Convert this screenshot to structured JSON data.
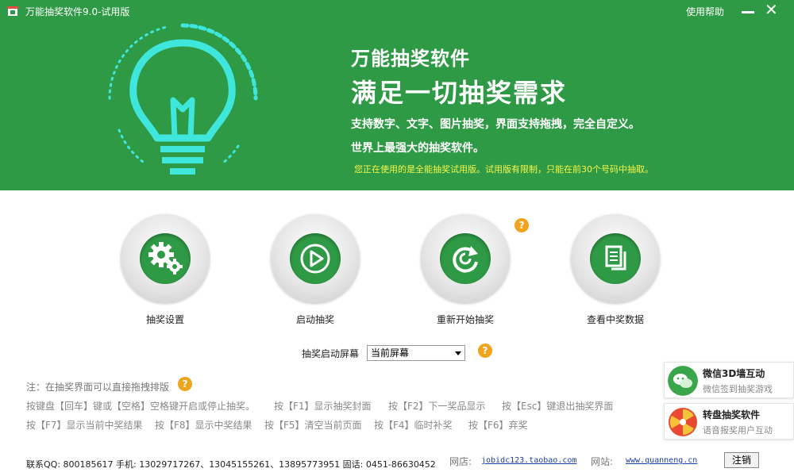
{
  "window": {
    "title": "万能抽奖软件9.0-试用版",
    "help_label": "使用帮助",
    "minimize_icon": "minimize-icon",
    "close_icon": "close-icon"
  },
  "banner": {
    "slogan_line1": "万能抽奖软件",
    "slogan_line2": "满足一切抽奖需求",
    "description1": "支持数字、文字、图片抽奖，界面支持拖拽，完全自定义。",
    "description2": "世界上最强大的抽奖软件。",
    "trial_notice": "您正在使用的是全能抽奖试用版。试用版有限制，只能在前30个号码中抽取。",
    "accent_color": "#2f9a45",
    "notice_color": "#f5f54a"
  },
  "actions": [
    {
      "label": "抽奖设置",
      "icon": "gears-icon"
    },
    {
      "label": "启动抽奖",
      "icon": "play-icon"
    },
    {
      "label": "重新开始抽奖",
      "icon": "restart-icon"
    },
    {
      "label": "查看中奖数据",
      "icon": "documents-icon"
    }
  ],
  "screen_select": {
    "label": "抽奖启动屏幕",
    "value": "当前屏幕"
  },
  "tips": {
    "note": "注：在抽奖界面可以直接拖拽排版",
    "hotkeys_row1": [
      "按键盘【回车】键或【空格】空格键开启或停止抽奖。",
      "按【F1】显示抽奖封面",
      "按【F2】下一奖品显示",
      "按【Esc】键退出抽奖界面"
    ],
    "hotkeys_row2": [
      "按【F7】显示当前中奖结果",
      "按【F8】显示中奖结果",
      "按【F5】清空当前页面",
      "按【F4】临时补奖",
      "按【F6】弃奖"
    ]
  },
  "footer": {
    "contact": "联系QQ: 800185617  手机: 13029717267、13045155261、13895773951  固话: 0451-86630452",
    "shop_label": "网店:",
    "shop_link": "jobidc123.taobao.com",
    "site_label": "网站:",
    "site_link": "www.quanneng.cn",
    "logout_label": "注销"
  },
  "side_cards": [
    {
      "title": "微信3D墙互动",
      "subtitle": "微信签到抽奖游戏",
      "icon": "wechat-3d-icon"
    },
    {
      "title": "转盘抽奖软件",
      "subtitle": "语音报奖用户互动",
      "icon": "wheel-icon"
    }
  ]
}
